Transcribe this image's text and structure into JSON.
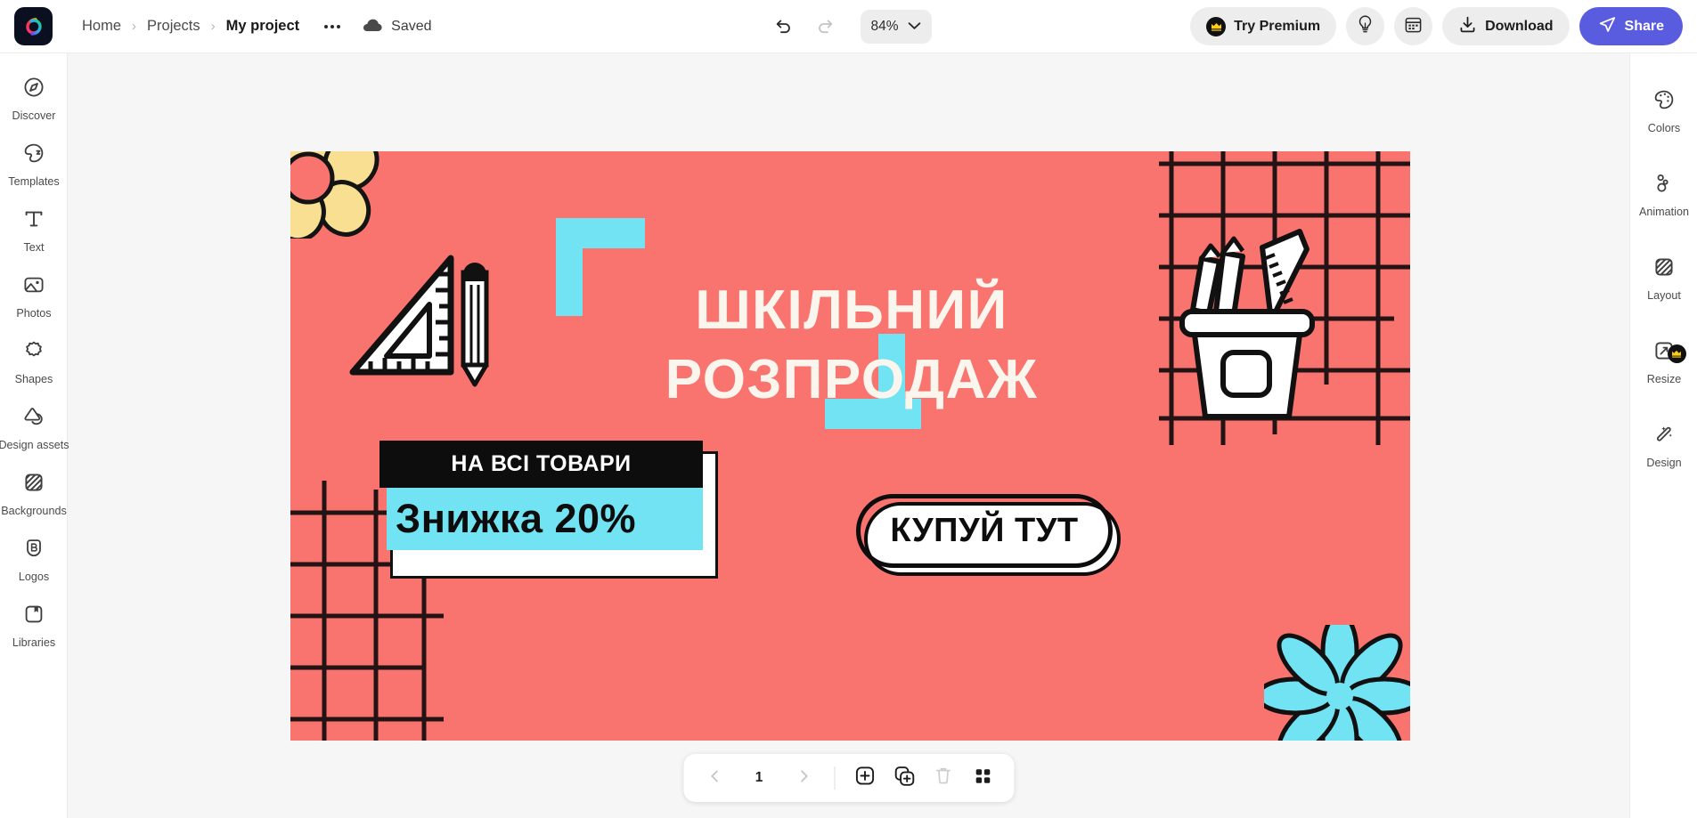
{
  "app": {
    "name": "Adobe Express",
    "logo_icon": "adobe-express-logo"
  },
  "breadcrumb": {
    "items": [
      {
        "label": "Home",
        "active": false
      },
      {
        "label": "Projects",
        "active": false
      },
      {
        "label": "My project",
        "active": true
      }
    ],
    "separator": "›",
    "more_icon": "ellipsis-icon"
  },
  "save_status": {
    "icon": "cloud-icon",
    "label": "Saved"
  },
  "center_tools": {
    "undo_icon": "undo-icon",
    "redo_icon": "redo-icon",
    "zoom_value": "84%",
    "zoom_chevron_icon": "chevron-down-icon"
  },
  "right_tools": {
    "try_premium_label": "Try Premium",
    "try_premium_icon": "crown-icon",
    "ideas_icon": "lightbulb-icon",
    "calendar_icon": "calendar-icon",
    "download_label": "Download",
    "download_icon": "download-icon",
    "share_label": "Share",
    "share_icon": "send-icon"
  },
  "left_rail": {
    "items": [
      {
        "label": "Discover",
        "icon": "compass-icon"
      },
      {
        "label": "Templates",
        "icon": "templates-icon"
      },
      {
        "label": "Text",
        "icon": "text-t-icon"
      },
      {
        "label": "Photos",
        "icon": "photo-icon"
      },
      {
        "label": "Shapes",
        "icon": "shapes-icon"
      },
      {
        "label": "Design assets",
        "icon": "design-assets-icon"
      },
      {
        "label": "Backgrounds",
        "icon": "backgrounds-icon"
      },
      {
        "label": "Logos",
        "icon": "logos-brand-icon"
      },
      {
        "label": "Libraries",
        "icon": "libraries-icon"
      }
    ]
  },
  "right_rail": {
    "items": [
      {
        "label": "Colors",
        "icon": "palette-icon",
        "premium": false
      },
      {
        "label": "Animation",
        "icon": "animation-icon",
        "premium": false
      },
      {
        "label": "Layout",
        "icon": "layout-icon",
        "premium": false
      },
      {
        "label": "Resize",
        "icon": "resize-icon",
        "premium": true
      },
      {
        "label": "Design",
        "icon": "magic-wand-icon",
        "premium": false
      }
    ],
    "premium_badge_icon": "crown-icon"
  },
  "page_bar": {
    "prev_icon": "chevron-left-icon",
    "page_number": "1",
    "next_icon": "chevron-right-icon",
    "add_page_icon": "plus-square-icon",
    "duplicate_page_icon": "duplicate-icon",
    "delete_page_icon": "trash-icon",
    "grid_view_icon": "grid-view-icon"
  },
  "canvas": {
    "background_color": "#f9746e",
    "headline_line1": "ШКІЛЬНИЙ",
    "headline_line2": "РОЗПРОДАЖ",
    "headline_color": "#faf6ee",
    "badge_top_label": "НА ВСІ ТОВАРИ",
    "badge_bottom_label": "Знижка 20%",
    "cta_label": "КУПУЙ ТУТ",
    "accent_cyan": "#72e3f2",
    "accent_yellow": "#f9df92",
    "ink_black": "#0d0d0d",
    "paper_white": "#ffffff",
    "decorations": [
      "yellow-flower-top-left",
      "cyan-flower-bottom-right",
      "ruler-triangle-and-pencil",
      "pencil-cup-with-ruler",
      "grid-lines-top-right",
      "grid-lines-bottom-left",
      "cyan-brush-stroke-left",
      "cyan-brush-stroke-right"
    ]
  }
}
